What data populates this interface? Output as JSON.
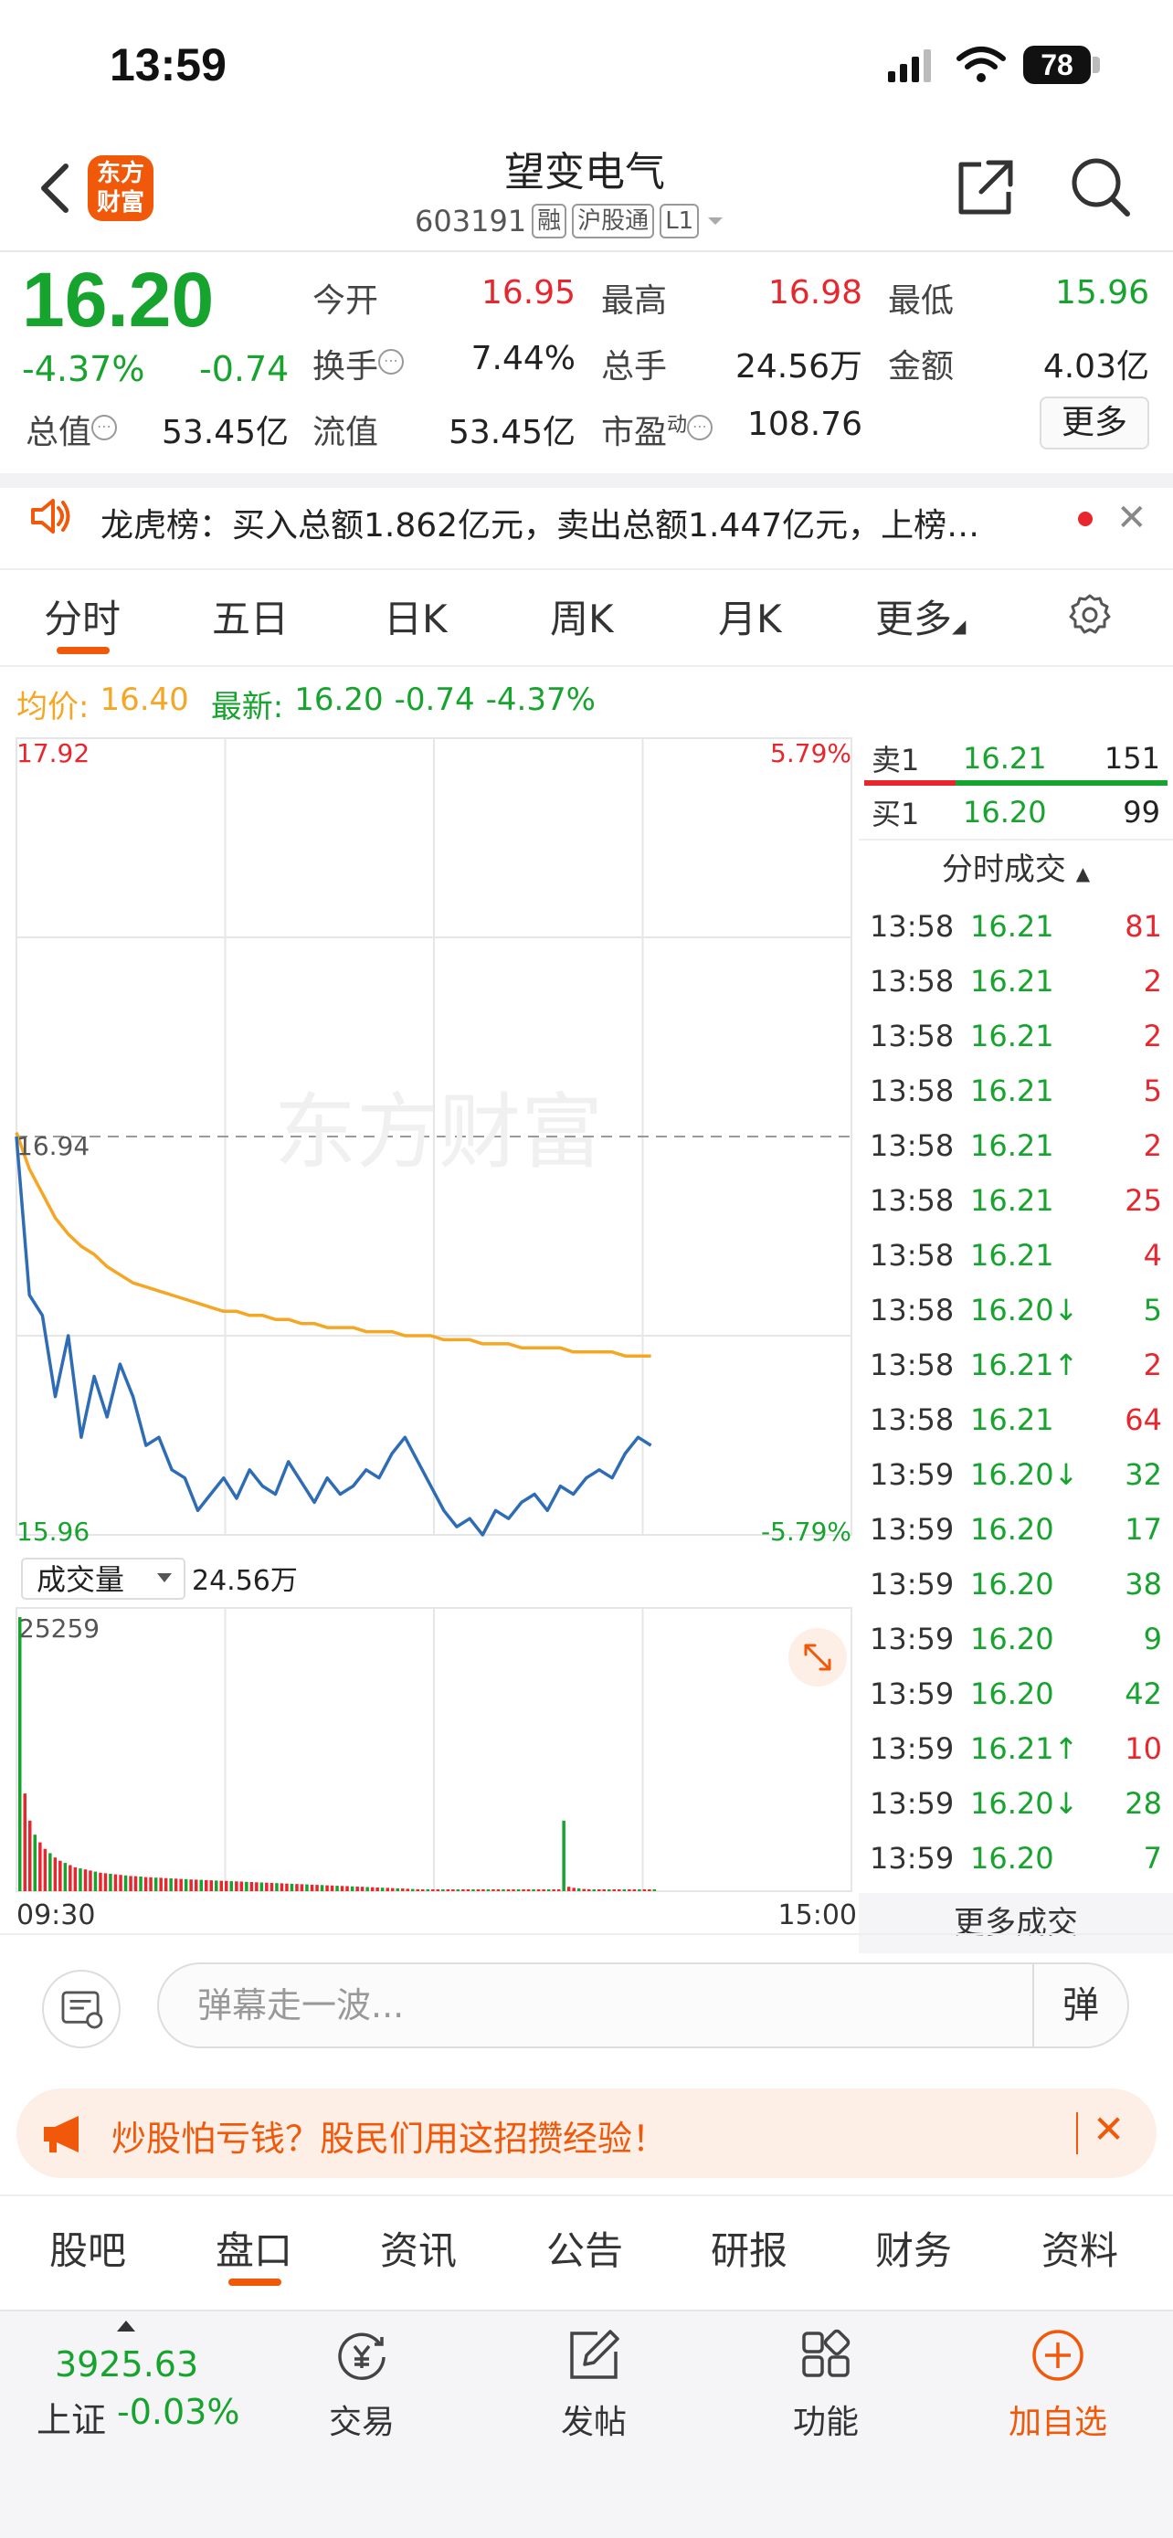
{
  "status_bar": {
    "time": "13:59",
    "battery": "78"
  },
  "header": {
    "logo_line1": "东方",
    "logo_line2": "财富",
    "stock_name": "望变电气",
    "stock_code": "603191",
    "tags": [
      "融",
      "沪股通",
      "L1"
    ]
  },
  "quote": {
    "price": "16.20",
    "change_pct": "-4.37%",
    "change_amt": "-0.74",
    "fields": {
      "open_label": "今开",
      "open": "16.95",
      "high_label": "最高",
      "high": "16.98",
      "low_label": "最低",
      "low": "15.96",
      "turnover_label": "换手",
      "turnover": "7.44%",
      "volume_label": "总手",
      "volume": "24.56万",
      "amount_label": "金额",
      "amount": "4.03亿",
      "total_mv_label": "总值",
      "total_mv": "53.45亿",
      "float_mv_label": "流值",
      "float_mv": "53.45亿",
      "pe_label": "市盈",
      "pe_sup": "动",
      "pe": "108.76"
    },
    "more_label": "更多"
  },
  "notice": {
    "text": "龙虎榜：买入总额1.862亿元，卖出总额1.447亿元，上榜…"
  },
  "chart_tabs": [
    "分时",
    "五日",
    "日K",
    "周K",
    "月K",
    "更多"
  ],
  "avg_row": {
    "avg_label": "均价:",
    "avg_value": "16.40",
    "latest_label": "最新:",
    "latest_value": "16.20",
    "latest_change": "-0.74",
    "latest_pct": "-4.37%"
  },
  "chart_data": {
    "type": "line",
    "y_max_label": "17.92",
    "y_min_label": "15.96",
    "y_max_pct": "5.79%",
    "y_min_pct": "-5.79%",
    "prev_close_label": "16.94",
    "ylim": [
      15.96,
      17.92
    ],
    "x_start_label": "09:30",
    "x_end_label": "15:00",
    "watermark": "东方财富",
    "volume_selector": "成交量",
    "volume_total": "24.56万",
    "volume_max_label": "25259",
    "series": [
      {
        "name": "均价",
        "values": [
          16.95,
          16.86,
          16.8,
          16.74,
          16.7,
          16.67,
          16.65,
          16.62,
          16.6,
          16.58,
          16.57,
          16.56,
          16.55,
          16.54,
          16.53,
          16.52,
          16.51,
          16.51,
          16.5,
          16.5,
          16.49,
          16.49,
          16.48,
          16.48,
          16.47,
          16.47,
          16.47,
          16.46,
          16.46,
          16.46,
          16.45,
          16.45,
          16.45,
          16.44,
          16.44,
          16.44,
          16.43,
          16.43,
          16.43,
          16.42,
          16.42,
          16.42,
          16.42,
          16.41,
          16.41,
          16.41,
          16.41,
          16.4,
          16.4,
          16.4
        ]
      },
      {
        "name": "价格",
        "values": [
          16.94,
          16.55,
          16.5,
          16.3,
          16.45,
          16.2,
          16.35,
          16.25,
          16.38,
          16.3,
          16.18,
          16.2,
          16.12,
          16.1,
          16.02,
          16.06,
          16.1,
          16.05,
          16.12,
          16.08,
          16.06,
          16.14,
          16.09,
          16.04,
          16.1,
          16.06,
          16.08,
          16.12,
          16.1,
          16.16,
          16.2,
          16.14,
          16.08,
          16.02,
          15.98,
          16.0,
          15.96,
          16.02,
          16.0,
          16.04,
          16.06,
          16.02,
          16.08,
          16.06,
          16.1,
          16.12,
          16.1,
          16.16,
          16.2,
          16.18
        ]
      }
    ],
    "volume_values": [
      25259,
      9000,
      6500,
      5200,
      4500,
      3900,
      3500,
      3100,
      2800,
      2600,
      2400,
      2200,
      2100,
      2000,
      1900,
      1800,
      1700,
      1650,
      1600,
      1550,
      1500,
      1450,
      1400,
      1380,
      1350,
      1300,
      1280,
      1250,
      1230,
      1200,
      1180,
      1150,
      1130,
      1100,
      1080,
      1060,
      1040,
      1020,
      1000,
      980,
      960,
      940,
      920,
      900,
      880,
      860,
      840,
      820,
      800,
      780,
      760,
      740,
      720,
      700,
      680,
      660,
      640,
      620,
      600,
      580,
      560,
      540,
      520,
      500,
      480,
      460,
      440,
      420,
      400,
      380,
      360,
      340,
      320,
      300,
      280,
      260,
      240,
      220,
      200,
      180,
      160,
      140,
      120,
      100,
      90,
      80,
      70,
      60,
      55,
      50,
      45,
      40,
      35,
      30,
      28,
      26,
      24,
      22,
      20,
      18,
      16,
      14,
      12,
      10,
      8,
      6,
      4,
      2,
      6500,
      400,
      300,
      250,
      200,
      180,
      160,
      140,
      120,
      100,
      90,
      80,
      70,
      60,
      50,
      40,
      30,
      20,
      10
    ]
  },
  "order_book": {
    "sell_label": "卖1",
    "sell_price": "16.21",
    "sell_vol": "151",
    "buy_label": "买1",
    "buy_price": "16.20",
    "buy_vol": "99",
    "trades_header": "分时成交",
    "trades": [
      {
        "time": "13:58",
        "price": "16.21",
        "vol": "81",
        "dir": "",
        "pc": "green",
        "vc": "red"
      },
      {
        "time": "13:58",
        "price": "16.21",
        "vol": "2",
        "dir": "",
        "pc": "green",
        "vc": "red"
      },
      {
        "time": "13:58",
        "price": "16.21",
        "vol": "2",
        "dir": "",
        "pc": "green",
        "vc": "red"
      },
      {
        "time": "13:58",
        "price": "16.21",
        "vol": "5",
        "dir": "",
        "pc": "green",
        "vc": "red"
      },
      {
        "time": "13:58",
        "price": "16.21",
        "vol": "2",
        "dir": "",
        "pc": "green",
        "vc": "red"
      },
      {
        "time": "13:58",
        "price": "16.21",
        "vol": "25",
        "dir": "",
        "pc": "green",
        "vc": "red"
      },
      {
        "time": "13:58",
        "price": "16.21",
        "vol": "4",
        "dir": "",
        "pc": "green",
        "vc": "red"
      },
      {
        "time": "13:58",
        "price": "16.20",
        "vol": "5",
        "dir": "↓",
        "pc": "green",
        "vc": "green"
      },
      {
        "time": "13:58",
        "price": "16.21",
        "vol": "2",
        "dir": "↑",
        "pc": "green",
        "vc": "red"
      },
      {
        "time": "13:58",
        "price": "16.21",
        "vol": "64",
        "dir": "",
        "pc": "green",
        "vc": "red"
      },
      {
        "time": "13:59",
        "price": "16.20",
        "vol": "32",
        "dir": "↓",
        "pc": "green",
        "vc": "green"
      },
      {
        "time": "13:59",
        "price": "16.20",
        "vol": "17",
        "dir": "",
        "pc": "green",
        "vc": "green"
      },
      {
        "time": "13:59",
        "price": "16.20",
        "vol": "38",
        "dir": "",
        "pc": "green",
        "vc": "green"
      },
      {
        "time": "13:59",
        "price": "16.20",
        "vol": "9",
        "dir": "",
        "pc": "green",
        "vc": "green"
      },
      {
        "time": "13:59",
        "price": "16.20",
        "vol": "42",
        "dir": "",
        "pc": "green",
        "vc": "green"
      },
      {
        "time": "13:59",
        "price": "16.21",
        "vol": "10",
        "dir": "↑",
        "pc": "green",
        "vc": "red"
      },
      {
        "time": "13:59",
        "price": "16.20",
        "vol": "28",
        "dir": "↓",
        "pc": "green",
        "vc": "green"
      },
      {
        "time": "13:59",
        "price": "16.20",
        "vol": "7",
        "dir": "",
        "pc": "green",
        "vc": "green"
      }
    ],
    "more_trades": "更多成交"
  },
  "comment": {
    "placeholder": "弹幕走一波...",
    "danmu": "弹"
  },
  "promo": {
    "text": "炒股怕亏钱？股民们用这招攒经验！"
  },
  "sub_tabs": [
    "股吧",
    "盘口",
    "资讯",
    "公告",
    "研报",
    "财务",
    "资料"
  ],
  "tab_bar": {
    "index_value": "3925.63",
    "index_label": "上证",
    "index_change": "-0.03%",
    "items": [
      "交易",
      "发帖",
      "功能",
      "加自选"
    ]
  },
  "colors": {
    "accent": "#f0580a",
    "up": "#e8262d",
    "down": "#16a32e",
    "avg_line": "#f5a623",
    "price_line": "#2e6db5"
  }
}
